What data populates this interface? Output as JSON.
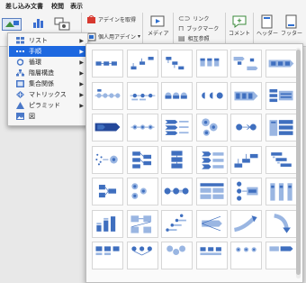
{
  "ribbon": {
    "tabs": [
      "差し込み文書",
      "校閲",
      "表示"
    ],
    "design_take_label": "アデインを取得",
    "personal_addin_label": "個人用アデイン",
    "media_label": "メディア",
    "links": {
      "link": "リンク",
      "bookmark": "ブックマーク",
      "cross_ref": "相互参照"
    },
    "comment_label": "コメント",
    "header_label": "ヘッダー",
    "footer_label": "フッター"
  },
  "menu": {
    "items": [
      {
        "label": "リスト",
        "icon": "list-icon",
        "selected": false
      },
      {
        "label": "手順",
        "icon": "process-icon",
        "selected": true
      },
      {
        "label": "循環",
        "icon": "cycle-icon",
        "selected": false
      },
      {
        "label": "階層構造",
        "icon": "hierarchy-icon",
        "selected": false
      },
      {
        "label": "集合関係",
        "icon": "relationship-icon",
        "selected": false
      },
      {
        "label": "マトリックス",
        "icon": "matrix-icon",
        "selected": false
      },
      {
        "label": "ピラミッド",
        "icon": "pyramid-icon",
        "selected": false
      },
      {
        "label": "図",
        "icon": "picture-icon",
        "selected": false
      }
    ],
    "submenu_arrow": "▶"
  },
  "gallery": {
    "columns": 6,
    "thumbnails": [
      "basic-process",
      "step-up-process",
      "step-down-process",
      "accent-process",
      "alternating-flow",
      "continuous-block-process",
      "circle-accent-timeline",
      "basic-timeline",
      "half-circle-process",
      "arrow-circle-process",
      "process-arrows",
      "segmented-process",
      "block-arrow-process",
      "circle-process",
      "chevron-list",
      "gear-process",
      "circle-arrow-process",
      "phased-process",
      "random-to-result",
      "repeating-bending-process",
      "vertical-process",
      "vertical-chevron-list",
      "upward-step-process",
      "staggered-process",
      "interconnected-blocks",
      "circular-bending-process",
      "equation",
      "process-list",
      "vertical-equation",
      "linear-venn-table",
      "bar-chart-process",
      "bending-picture-process",
      "staircase-process",
      "diverging-arrows",
      "curved-arrow",
      "down-arrow",
      "picture-process",
      "converging-process",
      "gear-stack",
      "box-process",
      "cycle-row",
      "mixed-process"
    ]
  }
}
